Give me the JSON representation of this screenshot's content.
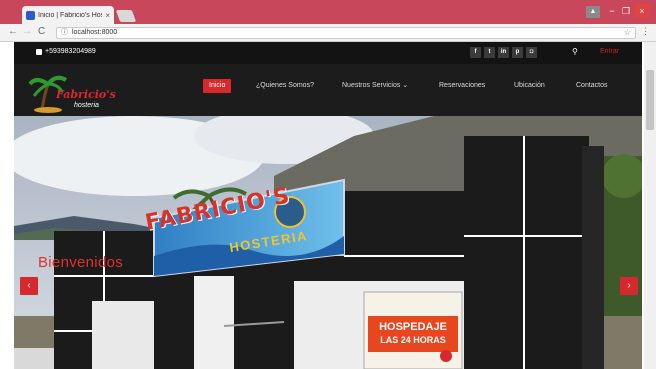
{
  "browser": {
    "tab_title": "Inicio | Fabricio's Hoste",
    "tab_close": "×",
    "url": "localhost:8000",
    "window_buttons": [
      "−",
      "❐",
      "×"
    ]
  },
  "topbar": {
    "phone": "+593983204989",
    "social_icons": [
      "facebook-icon",
      "twitter-icon",
      "linkedin-icon",
      "pinterest-icon",
      "instagram-icon"
    ],
    "social_glyphs": [
      "f",
      "t",
      "in",
      "p",
      "◘"
    ],
    "search_glyph": "⚲",
    "login_label": "Entrar"
  },
  "logo": {
    "brand": "Fabricio's",
    "sub": "hosteria"
  },
  "nav": {
    "items": [
      {
        "label": "Inicio",
        "active": true
      },
      {
        "label": "¿Quienes Somos?"
      },
      {
        "label": "Nuestros Servicios ⌄"
      },
      {
        "label": "Reservaciones"
      },
      {
        "label": "Ubicación"
      },
      {
        "label": "Contactos"
      }
    ]
  },
  "hero": {
    "welcome": "Bienvenidos",
    "sign_main": "FABRICIO'S",
    "sign_sub": "HOSTERIA",
    "banner_line1": "HOSPEDAJE",
    "banner_line2": "LAS 24 HORAS",
    "prev": "‹",
    "next": "›"
  },
  "colors": {
    "accent": "#d7282d",
    "tabbar": "#c8475b",
    "topbar": "#131313",
    "nav": "#1c1c1c"
  }
}
